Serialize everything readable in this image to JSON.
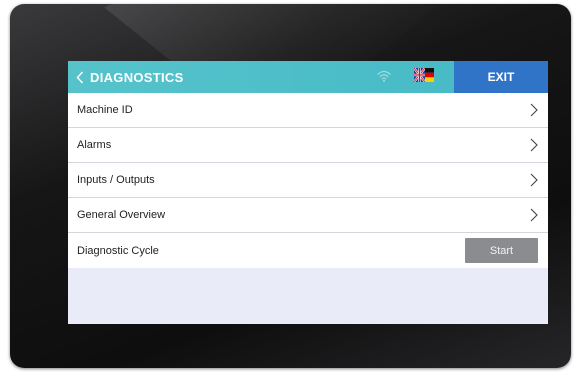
{
  "header": {
    "title": "DIAGNOSTICS",
    "back_icon": "chevron-left-icon",
    "wifi_icon": "wifi-icon",
    "language_icon": "language-flag-icon",
    "exit_label": "EXIT"
  },
  "menu": {
    "items": [
      {
        "label": "Machine ID",
        "icon": "chevron-right-icon"
      },
      {
        "label": "Alarms",
        "icon": "chevron-right-icon"
      },
      {
        "label": "Inputs / Outputs",
        "icon": "chevron-right-icon"
      },
      {
        "label": "General Overview",
        "icon": "chevron-right-icon"
      }
    ],
    "cycle": {
      "label": "Diagnostic Cycle",
      "button_label": "Start"
    }
  },
  "colors": {
    "header_bg": "#4ab9c5",
    "exit_bg": "#2f74c6",
    "start_bg": "#8a8c8f",
    "screen_bg": "#e9ebf8"
  }
}
